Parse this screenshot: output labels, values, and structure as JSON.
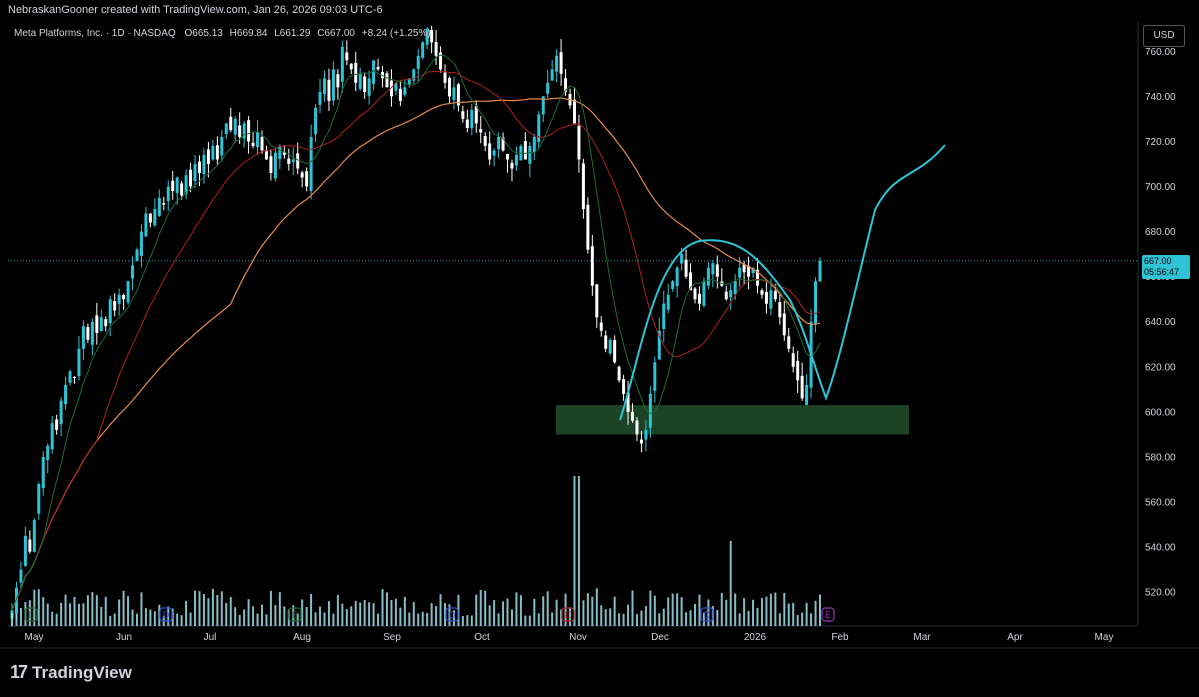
{
  "header": {
    "credit": "NebraskanGooner created with TradingView.com, Jan 26, 2026 09:03 UTC-6"
  },
  "legend": {
    "name": "Meta Platforms, Inc. · 1D · NASDAQ",
    "open": "O665.13",
    "high": "H669.84",
    "low": "L661.29",
    "close": "C667.00",
    "change": "+8.24 (+1.25%)"
  },
  "currency": "USD",
  "brand": "TradingView",
  "last_price": {
    "price": "667.00",
    "countdown": "05:56:47"
  },
  "colors": {
    "background": "#000000",
    "up_candle": "#2ec4d6",
    "down_candle": "#ffffff",
    "ma_long": "#e8894a",
    "ma_mid": "#b02020",
    "ma_short": "#1e6b35",
    "projection": "#2ec4d6",
    "support_zone": "#1f4a2a",
    "volume": "#9fdde6"
  },
  "chart_data": {
    "type": "candlestick",
    "title": "Meta Platforms, Inc. · 1D · NASDAQ",
    "ylim": [
      505,
      773
    ],
    "y_ticks": [
      520,
      540,
      560,
      580,
      600,
      620,
      640,
      660,
      680,
      700,
      720,
      740,
      760
    ],
    "x_ticks": [
      "May",
      "Jun",
      "Jul",
      "Aug",
      "Sep",
      "Oct",
      "Nov",
      "Dec",
      "2026",
      "Feb",
      "Mar",
      "Apr",
      "May"
    ],
    "series": [
      {
        "type": "close",
        "values": [
          512,
          522,
          530,
          545,
          538,
          552,
          568,
          580,
          585,
          595,
          592,
          605,
          612,
          618,
          615,
          628,
          638,
          632,
          640,
          635,
          642,
          638,
          650,
          645,
          652,
          650,
          658,
          665,
          672,
          680,
          688,
          684,
          690,
          695,
          692,
          700,
          698,
          704,
          696,
          705,
          700,
          710,
          706,
          714,
          710,
          718,
          712,
          722,
          728,
          725,
          730,
          722,
          728,
          720,
          718,
          724,
          716,
          712,
          706,
          715,
          718,
          714,
          710,
          712,
          708,
          704,
          700,
          722,
          735,
          742,
          748,
          738,
          752,
          744,
          762,
          756,
          752,
          746,
          750,
          742,
          748,
          756,
          752,
          748,
          744,
          740,
          746,
          738,
          744,
          748,
          752,
          758,
          764,
          770,
          764,
          758,
          752,
          746,
          740,
          744,
          736,
          730,
          726,
          734,
          728,
          724,
          718,
          712,
          716,
          722,
          716,
          712,
          708,
          714,
          718,
          712,
          718,
          722,
          732,
          740,
          746,
          752,
          758,
          750,
          742,
          736,
          728,
          712,
          690,
          672,
          656,
          642,
          636,
          628,
          632,
          622,
          614,
          608,
          600,
          596,
          590,
          586,
          592,
          608,
          622,
          636,
          648,
          652,
          658,
          664,
          670,
          660,
          654,
          650,
          648,
          658,
          664,
          666,
          660,
          656,
          650,
          654,
          658,
          664,
          662,
          660,
          664,
          656,
          652,
          648,
          654,
          650,
          642,
          634,
          628,
          620,
          614,
          606,
          612,
          640,
          658,
          667
        ]
      },
      {
        "name": "",
        "type": "ma",
        "values": []
      }
    ],
    "annotations": {
      "support_zone": {
        "from": 590,
        "to": 603
      },
      "last_close": 667.0
    }
  }
}
